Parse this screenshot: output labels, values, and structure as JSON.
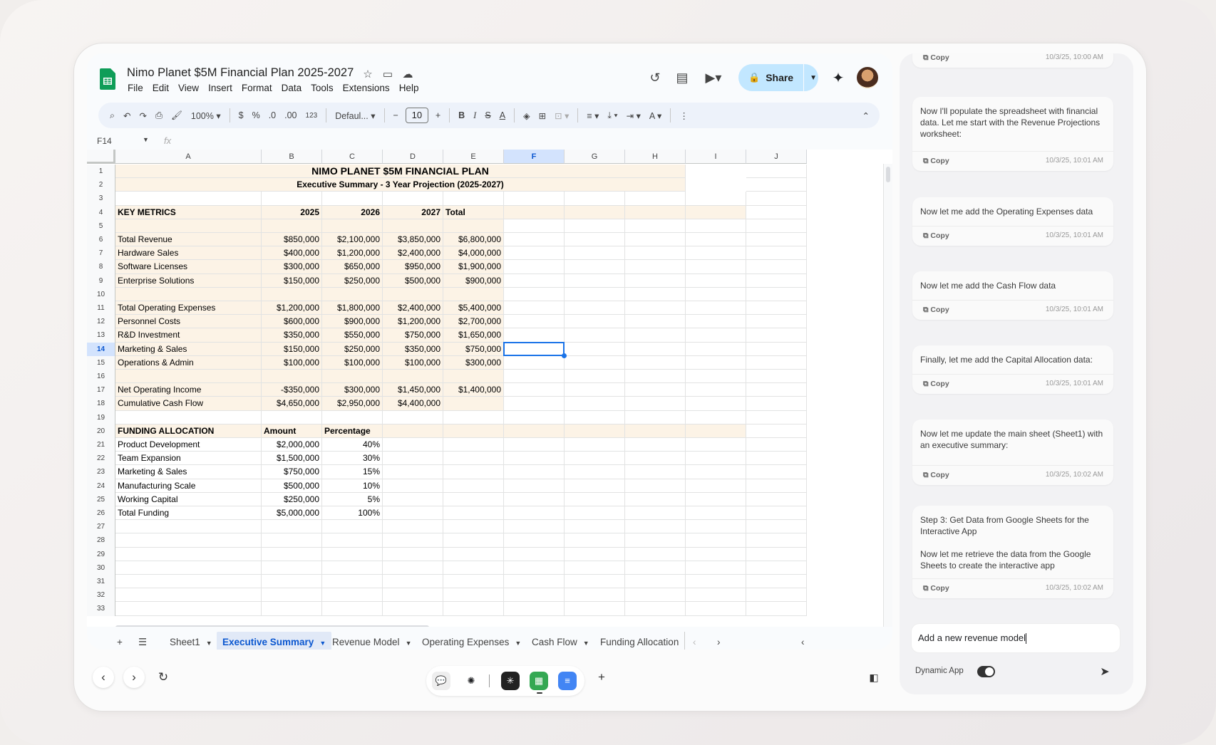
{
  "app": {
    "title": "Nimo Planet $5M Financial Plan 2025-2027",
    "menu": [
      "File",
      "Edit",
      "View",
      "Insert",
      "Format",
      "Data",
      "Tools",
      "Extensions",
      "Help"
    ],
    "share_label": "Share",
    "zoom": "100%",
    "font": "Defaul...",
    "font_size": "10",
    "currency": "$",
    "percent": "%",
    "dec_less": ".0",
    "dec_more": ".00",
    "number_format": "123",
    "name_box": "F14",
    "fx": "fx"
  },
  "columns": [
    "A",
    "B",
    "C",
    "D",
    "E",
    "F",
    "G",
    "H",
    "I",
    "J"
  ],
  "selected_column": "F",
  "selected_row": 14,
  "rows": [
    {
      "n": 1,
      "cells": [
        "NIMO PLANET $5M FINANCIAL PLAN",
        "",
        "",
        "",
        "",
        "",
        "",
        "",
        "",
        ""
      ]
    },
    {
      "n": 2,
      "cells": [
        "Executive Summary - 3 Year Projection (2025-2027)",
        "",
        "",
        "",
        "",
        "",
        "",
        "",
        "",
        ""
      ]
    },
    {
      "n": 3,
      "cells": [
        "",
        "",
        "",
        "",
        "",
        "",
        "",
        "",
        "",
        ""
      ]
    },
    {
      "n": 4,
      "cells": [
        "KEY METRICS",
        "2025",
        "2026",
        "2027",
        "Total",
        "",
        "",
        "",
        "",
        ""
      ]
    },
    {
      "n": 5,
      "cells": [
        "",
        "",
        "",
        "",
        "",
        "",
        "",
        "",
        "",
        ""
      ]
    },
    {
      "n": 6,
      "cells": [
        "Total Revenue",
        "$850,000",
        "$2,100,000",
        "$3,850,000",
        "$6,800,000",
        "",
        "",
        "",
        "",
        ""
      ]
    },
    {
      "n": 7,
      "cells": [
        "Hardware Sales",
        "$400,000",
        "$1,200,000",
        "$2,400,000",
        "$4,000,000",
        "",
        "",
        "",
        "",
        ""
      ]
    },
    {
      "n": 8,
      "cells": [
        "Software Licenses",
        "$300,000",
        "$650,000",
        "$950,000",
        "$1,900,000",
        "",
        "",
        "",
        "",
        ""
      ]
    },
    {
      "n": 9,
      "cells": [
        "Enterprise Solutions",
        "$150,000",
        "$250,000",
        "$500,000",
        "$900,000",
        "",
        "",
        "",
        "",
        ""
      ]
    },
    {
      "n": 10,
      "cells": [
        "",
        "",
        "",
        "",
        "",
        "",
        "",
        "",
        "",
        ""
      ]
    },
    {
      "n": 11,
      "cells": [
        "Total Operating Expenses",
        "$1,200,000",
        "$1,800,000",
        "$2,400,000",
        "$5,400,000",
        "",
        "",
        "",
        "",
        ""
      ]
    },
    {
      "n": 12,
      "cells": [
        "Personnel Costs",
        "$600,000",
        "$900,000",
        "$1,200,000",
        "$2,700,000",
        "",
        "",
        "",
        "",
        ""
      ]
    },
    {
      "n": 13,
      "cells": [
        "R&D Investment",
        "$350,000",
        "$550,000",
        "$750,000",
        "$1,650,000",
        "",
        "",
        "",
        "",
        ""
      ]
    },
    {
      "n": 14,
      "cells": [
        "Marketing & Sales",
        "$150,000",
        "$250,000",
        "$350,000",
        "$750,000",
        "",
        "",
        "",
        "",
        ""
      ]
    },
    {
      "n": 15,
      "cells": [
        "Operations & Admin",
        "$100,000",
        "$100,000",
        "$100,000",
        "$300,000",
        "",
        "",
        "",
        "",
        ""
      ]
    },
    {
      "n": 16,
      "cells": [
        "",
        "",
        "",
        "",
        "",
        "",
        "",
        "",
        "",
        ""
      ]
    },
    {
      "n": 17,
      "cells": [
        "Net Operating Income",
        "-$350,000",
        "$300,000",
        "$1,450,000",
        "$1,400,000",
        "",
        "",
        "",
        "",
        ""
      ]
    },
    {
      "n": 18,
      "cells": [
        "Cumulative Cash Flow",
        "$4,650,000",
        "$2,950,000",
        "$4,400,000",
        "",
        "",
        "",
        "",
        "",
        ""
      ]
    },
    {
      "n": 19,
      "cells": [
        "",
        "",
        "",
        "",
        "",
        "",
        "",
        "",
        "",
        ""
      ]
    },
    {
      "n": 20,
      "cells": [
        "FUNDING ALLOCATION",
        "Amount",
        "Percentage",
        "",
        "",
        "",
        "",
        "",
        "",
        ""
      ]
    },
    {
      "n": 21,
      "cells": [
        "Product Development",
        "$2,000,000",
        "40%",
        "",
        "",
        "",
        "",
        "",
        "",
        ""
      ]
    },
    {
      "n": 22,
      "cells": [
        "Team Expansion",
        "$1,500,000",
        "30%",
        "",
        "",
        "",
        "",
        "",
        "",
        ""
      ]
    },
    {
      "n": 23,
      "cells": [
        "Marketing & Sales",
        "$750,000",
        "15%",
        "",
        "",
        "",
        "",
        "",
        "",
        ""
      ]
    },
    {
      "n": 24,
      "cells": [
        "Manufacturing Scale",
        "$500,000",
        "10%",
        "",
        "",
        "",
        "",
        "",
        "",
        ""
      ]
    },
    {
      "n": 25,
      "cells": [
        "Working Capital",
        "$250,000",
        "5%",
        "",
        "",
        "",
        "",
        "",
        "",
        ""
      ]
    },
    {
      "n": 26,
      "cells": [
        "Total Funding",
        "$5,000,000",
        "100%",
        "",
        "",
        "",
        "",
        "",
        "",
        ""
      ]
    },
    {
      "n": 27,
      "cells": [
        "",
        "",
        "",
        "",
        "",
        "",
        "",
        "",
        "",
        ""
      ]
    },
    {
      "n": 28,
      "cells": [
        "",
        "",
        "",
        "",
        "",
        "",
        "",
        "",
        "",
        ""
      ]
    },
    {
      "n": 29,
      "cells": [
        "",
        "",
        "",
        "",
        "",
        "",
        "",
        "",
        "",
        ""
      ]
    },
    {
      "n": 30,
      "cells": [
        "",
        "",
        "",
        "",
        "",
        "",
        "",
        "",
        "",
        ""
      ]
    },
    {
      "n": 31,
      "cells": [
        "",
        "",
        "",
        "",
        "",
        "",
        "",
        "",
        "",
        ""
      ]
    },
    {
      "n": 32,
      "cells": [
        "",
        "",
        "",
        "",
        "",
        "",
        "",
        "",
        "",
        ""
      ]
    },
    {
      "n": 33,
      "cells": [
        "",
        "",
        "",
        "",
        "",
        "",
        "",
        "",
        "",
        ""
      ]
    }
  ],
  "tabs": [
    {
      "label": "Sheet1",
      "active": false
    },
    {
      "label": "Executive Summary",
      "active": true
    },
    {
      "label": "Revenue Model",
      "active": false
    },
    {
      "label": "Operating Expenses",
      "active": false
    },
    {
      "label": "Cash Flow",
      "active": false
    },
    {
      "label": "Funding Allocation",
      "active": false
    }
  ],
  "chat": {
    "messages": [
      {
        "text": "",
        "time": "10/3/25, 10:00 AM"
      },
      {
        "text": "Now I'll populate the spreadsheet with financial data. Let me start with the Revenue Projections worksheet:",
        "time": "10/3/25, 10:01 AM"
      },
      {
        "text": "Now let me add the Operating Expenses data",
        "time": "10/3/25, 10:01 AM"
      },
      {
        "text": "Now let me add the Cash Flow data",
        "time": "10/3/25, 10:01 AM"
      },
      {
        "text": "Finally, let me add the Capital Allocation data:",
        "time": "10/3/25, 10:01 AM"
      },
      {
        "text": "Now let me update the main sheet (Sheet1) with an executive summary:",
        "time": "10/3/25, 10:02 AM"
      },
      {
        "text": "Step 3: Get Data from Google Sheets for the Interactive App\n\nNow let me retrieve the data from the Google Sheets to create the interactive app",
        "time": "10/3/25, 10:02 AM"
      }
    ],
    "copy_label": "Copy",
    "input_value": "Add a new revenue model",
    "dynamic_label": "Dynamic App",
    "dynamic_on": true
  },
  "colors": {
    "accent": "#0b57d0",
    "highlight": "#fcf3e6",
    "share_bg": "#c2e7ff"
  }
}
